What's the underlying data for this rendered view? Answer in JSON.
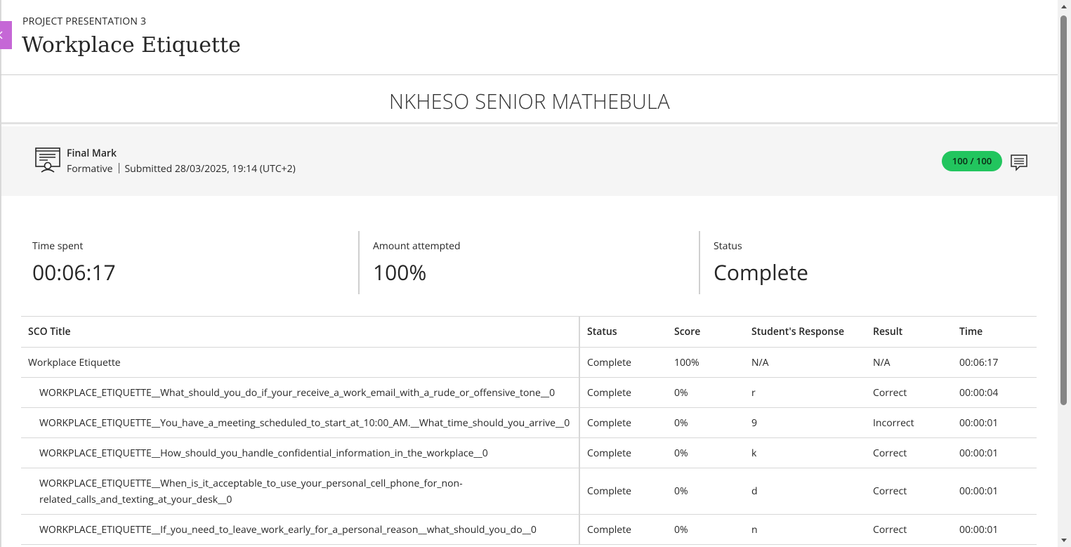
{
  "header": {
    "eyebrow": "PROJECT PRESENTATION 3",
    "title": "Workplace Etiquette",
    "back_icon": "chevron-left-icon",
    "accent": "#c567d6"
  },
  "student": {
    "name": "NKHESO SENIOR MATHEBULA"
  },
  "final_mark": {
    "label": "Final Mark",
    "type": "Formative",
    "submitted": "Submitted 28/03/2025, 19:14 (UTC+2)",
    "score": "100 / 100",
    "score_color": "#22c55e",
    "icon": "rubric-presentation-icon",
    "comment_icon": "comment-icon"
  },
  "stats": {
    "time_spent_label": "Time spent",
    "time_spent_value": "00:06:17",
    "attempted_label": "Amount attempted",
    "attempted_value": "100%",
    "status_label": "Status",
    "status_value": "Complete"
  },
  "table": {
    "headers": {
      "title": "SCO Title",
      "status": "Status",
      "score": "Score",
      "response": "Student's Response",
      "result": "Result",
      "time": "Time"
    },
    "rows": [
      {
        "title": "Workplace Etiquette",
        "status": "Complete",
        "score": "100%",
        "response": "N/A",
        "result": "N/A",
        "time": "00:06:17"
      },
      {
        "title": "WORKPLACE_ETIQUETTE__What_should_you_do_if_your_receive_a_work_email_with_a_rude_or_offensive_tone__0",
        "status": "Complete",
        "score": "0%",
        "response": "r",
        "result": "Correct",
        "time": "00:00:04"
      },
      {
        "title": "WORKPLACE_ETIQUETTE__You_have_a_meeting_scheduled_to_start_at_10:00_AM.__What_time_should_you_arrive__0",
        "status": "Complete",
        "score": "0%",
        "response": "9",
        "result": "Incorrect",
        "time": "00:00:01"
      },
      {
        "title": "WORKPLACE_ETIQUETTE__How_should_you_handle_confidential_information_in_the_workplace__0",
        "status": "Complete",
        "score": "0%",
        "response": "k",
        "result": "Correct",
        "time": "00:00:01"
      },
      {
        "title_line1": "WORKPLACE_ETIQUETTE__When_is_it_acceptable_to_use_your_personal_cell_phone_for_non-",
        "title_line2": "related_calls_and_texting_at_your_desk__0",
        "status": "Complete",
        "score": "0%",
        "response": "d",
        "result": "Correct",
        "time": "00:00:01"
      },
      {
        "title": "WORKPLACE_ETIQUETTE__If_you_need_to_leave_work_early_for_a_personal_reason__what_should_you_do__0",
        "status": "Complete",
        "score": "0%",
        "response": "n",
        "result": "Correct",
        "time": "00:00:01"
      }
    ]
  }
}
